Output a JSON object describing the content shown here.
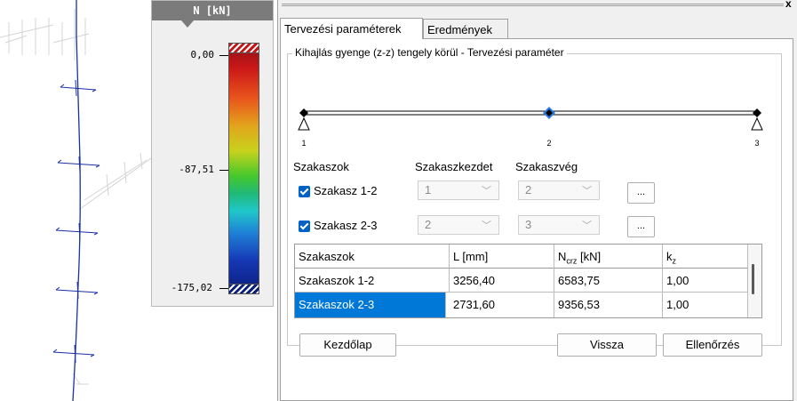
{
  "legend": {
    "header": "N [kN]",
    "max_label": "0,00",
    "mid_label": "-87,51",
    "min_label": "-175,02"
  },
  "tabs": {
    "params": "Tervezési paraméterek",
    "results": "Eredmények"
  },
  "group_title": "Kihajlás gyenge (z-z) tengely körül - Tervezési paraméter",
  "beam": {
    "node_labels": [
      "1",
      "2",
      "3"
    ]
  },
  "sections": {
    "header_sections": "Szakaszok",
    "header_start": "Szakaszkezdet",
    "header_end": "Szakaszvég",
    "rows": [
      {
        "label": "Szakasz 1-2",
        "start": "1",
        "end": "2",
        "button": "...",
        "checked": true
      },
      {
        "label": "Szakasz 2-3",
        "start": "2",
        "end": "3",
        "button": "...",
        "checked": true
      }
    ]
  },
  "table": {
    "headers": [
      "Szakaszok",
      "L [mm]",
      "Ncrz [kN]",
      "kz"
    ],
    "header_ncr_main": "N",
    "header_ncr_sub": "crz",
    "header_ncr_unit": " [kN]",
    "header_k_main": "k",
    "header_k_sub": "z",
    "rows": [
      [
        "Szakaszok 1-2",
        "3256,40",
        "6583,75",
        "1,00"
      ],
      [
        "Szakaszok 2-3",
        "2731,60",
        "9356,53",
        "1,00"
      ]
    ]
  },
  "buttons": {
    "home": "Kezdőlap",
    "back": "Vissza",
    "check": "Ellenőrzés"
  },
  "close_glyph": "x",
  "chevron_glyph": "﹀",
  "colors": {
    "accent": "#0078d7",
    "checkbox": "#0062c4",
    "member_line": "#1a2fa8",
    "header_bg": "#7b7b7b"
  }
}
